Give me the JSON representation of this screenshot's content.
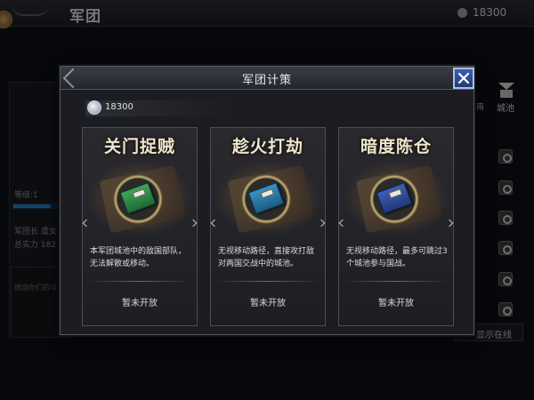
{
  "background": {
    "title": "军团",
    "currency_value": "18300",
    "level_label": "等级:1",
    "level_progress": 0.7,
    "leader_label": "军团长 虞女",
    "power_label": "总实力 182",
    "message_text": "燃烧你们的斗志吧",
    "tab_left": "南",
    "tab_city": "城池",
    "show_online_label": "显示在线"
  },
  "modal": {
    "title": "军团计策",
    "resource_value": "18300",
    "resource_icon": "silver-feather-icon",
    "close_icon": "close-x-icon",
    "close_color": "#2d4c99",
    "cards": [
      {
        "title": "关门捉贼",
        "description": "本军团城池中的敌国部队，无法解散或移动。",
        "status": "暂未开放",
        "book_icon": "green-book-icon",
        "book_color": "#2f8a47"
      },
      {
        "title": "趁火打劫",
        "description": "无视移动路径，直接攻打敌对两国交战中的城池。",
        "status": "暂未开放",
        "book_icon": "teal-book-icon",
        "book_color": "#2b79a8"
      },
      {
        "title": "暗度陈仓",
        "description": "无视移动路径，最多可跳过3个城池参与国战。",
        "status": "暂未开放",
        "book_icon": "blue-book-icon",
        "book_color": "#304d98"
      }
    ]
  }
}
